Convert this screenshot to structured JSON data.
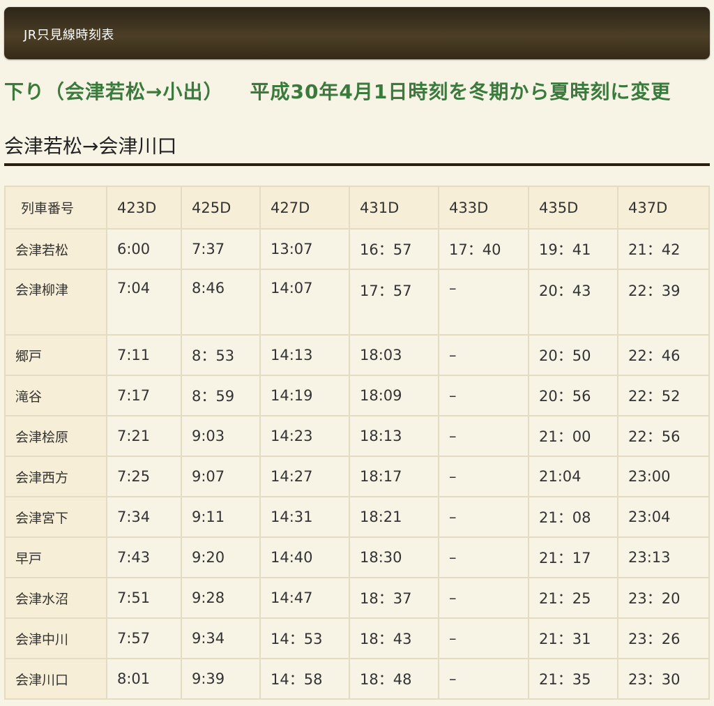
{
  "header": {
    "title": "JR只見線時刻表"
  },
  "direction": {
    "label": "下り（会津若松→小出）",
    "note": "平成30年4月1日時刻を冬期から夏時刻に変更"
  },
  "section": {
    "title": "会津若松→会津川口"
  },
  "timetable": {
    "corner_label": "列車番号",
    "trains": [
      "423D",
      "425D",
      "427D",
      "431D",
      "433D",
      "435D",
      "437D"
    ],
    "rows": [
      {
        "station": "会津若松",
        "times": [
          "6:00",
          "7:37",
          "13:07",
          "16：57",
          "17：40",
          "19：41",
          "21：42"
        ]
      },
      {
        "station": "会津柳津",
        "times": [
          "7:04",
          "8:46",
          "14:07",
          "17：57",
          "–",
          "20：43",
          "22：39"
        ]
      },
      {
        "station": "郷戸",
        "times": [
          "7:11",
          "8：53",
          "14:13",
          "18:03",
          "–",
          "20：50",
          "22：46"
        ]
      },
      {
        "station": "滝谷",
        "times": [
          "7:17",
          "8：59",
          "14:19",
          "18:09",
          "–",
          "20：56",
          "22：52"
        ]
      },
      {
        "station": "会津桧原",
        "times": [
          "7:21",
          "9:03",
          "14:23",
          "18:13",
          "–",
          "21：00",
          "22：56"
        ]
      },
      {
        "station": "会津西方",
        "times": [
          "7:25",
          "9:07",
          "14:27",
          "18:17",
          "–",
          "21:04",
          "23:00"
        ]
      },
      {
        "station": "会津宮下",
        "times": [
          "7:34",
          "9:11",
          "14:31",
          "18:21",
          "–",
          "21：08",
          "23:04"
        ]
      },
      {
        "station": "早戸",
        "times": [
          "7:43",
          "9:20",
          "14:40",
          "18:30",
          "–",
          "21：17",
          "23:13"
        ]
      },
      {
        "station": "会津水沼",
        "times": [
          "7:51",
          "9:28",
          "14:47",
          "18：37",
          "–",
          "21：25",
          "23：20"
        ]
      },
      {
        "station": "会津中川",
        "times": [
          "7:57",
          "9:34",
          "14：53",
          "18：43",
          "–",
          "21：31",
          "23：26"
        ]
      },
      {
        "station": "会津川口",
        "times": [
          "8:01",
          "9:39",
          "14：58",
          "18：48",
          "–",
          "21：35",
          "23：30"
        ]
      }
    ]
  }
}
